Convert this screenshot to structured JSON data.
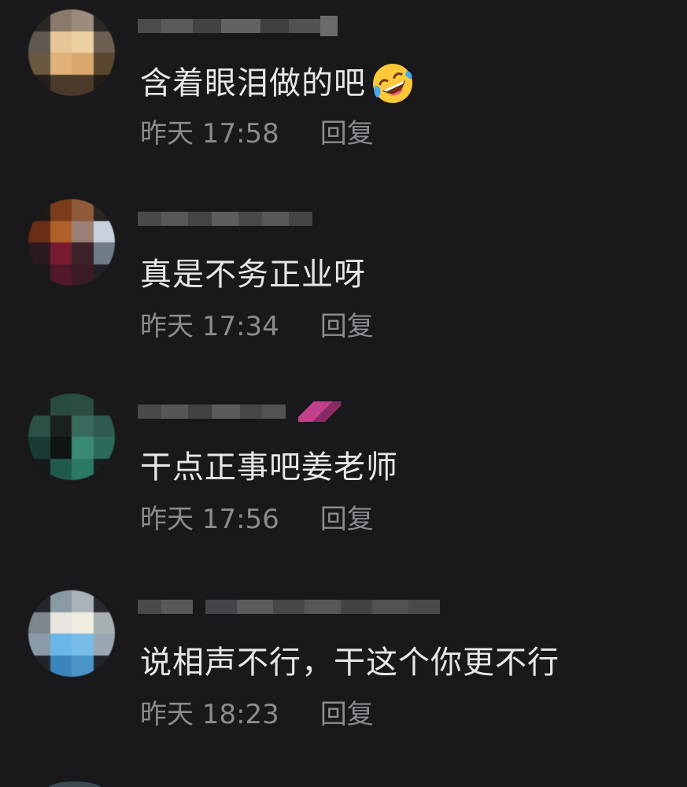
{
  "comments": [
    {
      "text": "含着眼泪做的吧",
      "emoji": "rolling-on-floor-laughing-icon",
      "time": "昨天 17:58",
      "reply_label": "回复"
    },
    {
      "text": "真是不务正业呀",
      "time": "昨天 17:34",
      "reply_label": "回复"
    },
    {
      "text": "干点正事吧姜老师",
      "time": "昨天 17:56",
      "reply_label": "回复"
    },
    {
      "text": "说相声不行，干这个你更不行",
      "time": "昨天 18:23",
      "reply_label": "回复"
    }
  ],
  "colors": {
    "background": "#19181b",
    "comment_text": "#e8e6ea",
    "meta_text": "#8c8a90"
  }
}
